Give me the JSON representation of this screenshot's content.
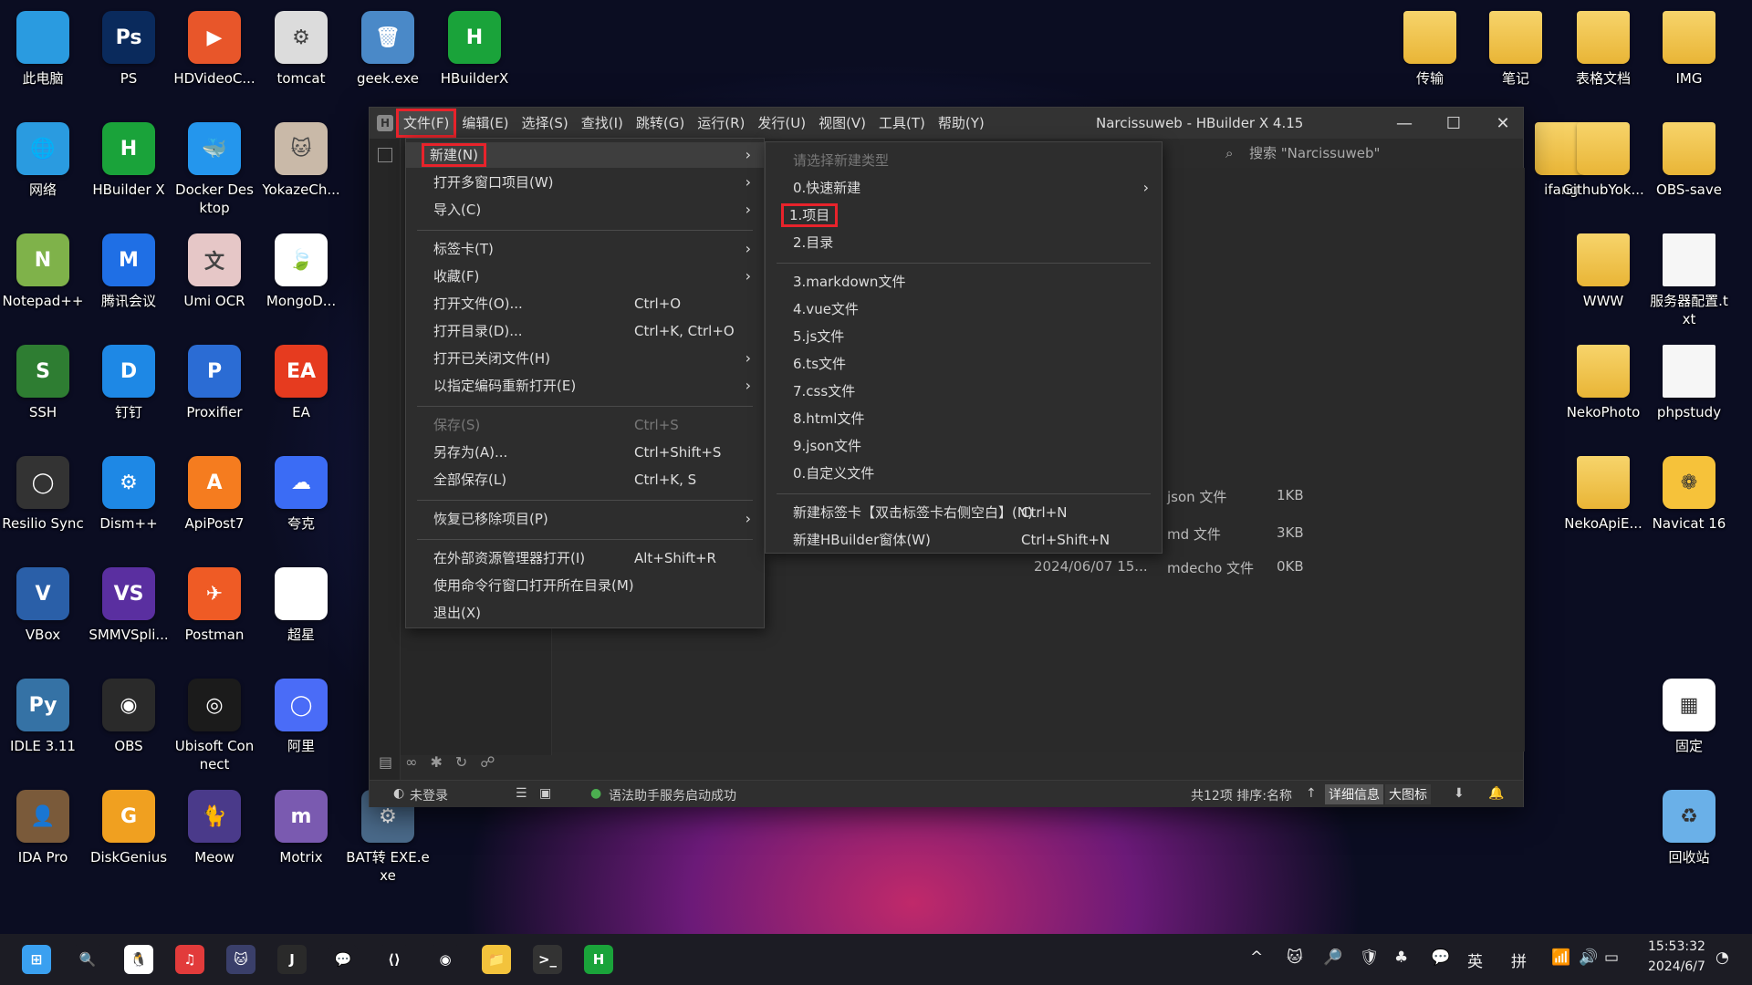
{
  "desktop_left": [
    {
      "label": "此电脑",
      "color": "#2a9be0",
      "icon": "monitor-icon"
    },
    {
      "label": "PS",
      "color": "#0a2a5c",
      "glyph": "Ps",
      "icon": "photoshop-icon"
    },
    {
      "label": "HDVideoC...",
      "color": "#e8562a",
      "glyph": "▶",
      "icon": "hdvideo-icon"
    },
    {
      "label": "tomcat",
      "color": "#dcdcdc",
      "glyph": "⚙",
      "icon": "gear-icon"
    },
    {
      "label": "geek.exe",
      "color": "#4a89c8",
      "glyph": "🗑",
      "icon": "geek-icon"
    },
    {
      "label": "HBuilderX",
      "color": "#1aa33a",
      "glyph": "H",
      "icon": "hbuilderx-icon"
    },
    {
      "label": "网络",
      "color": "#2a9be0",
      "glyph": "🌐",
      "icon": "network-icon"
    },
    {
      "label": "HBuilder X",
      "color": "#1aa33a",
      "glyph": "H",
      "icon": "hbuilder-icon"
    },
    {
      "label": "Docker Desktop",
      "color": "#2496ed",
      "glyph": "🐳",
      "icon": "docker-icon"
    },
    {
      "label": "YokazeCh...",
      "color": "#c9b9a8",
      "glyph": "🐱",
      "icon": "yokaze-icon"
    },
    {
      "label": "Notepad++",
      "color": "#7fb24a",
      "glyph": "N",
      "icon": "notepad-icon"
    },
    {
      "label": "腾讯会议",
      "color": "#1f6fe5",
      "glyph": "M",
      "icon": "tencent-meeting-icon"
    },
    {
      "label": "Umi OCR",
      "color": "#e6c7c7",
      "glyph": "文",
      "icon": "umi-ocr-icon"
    },
    {
      "label": "MongoD...",
      "color": "#ffffff",
      "glyph": "🍃",
      "icon": "mongodb-icon"
    },
    {
      "label": "SSH",
      "color": "#2e7d32",
      "glyph": "S",
      "icon": "ssh-icon"
    },
    {
      "label": "钉钉",
      "color": "#1e88e5",
      "glyph": "D",
      "icon": "dingtalk-icon"
    },
    {
      "label": "Proxifier",
      "color": "#2b6cd4",
      "glyph": "P",
      "icon": "proxifier-icon"
    },
    {
      "label": "EA",
      "color": "#e63b1f",
      "glyph": "EA",
      "icon": "ea-icon"
    },
    {
      "label": "Resilio Sync",
      "color": "#333333",
      "glyph": "◯",
      "icon": "resilio-icon"
    },
    {
      "label": "Dism++",
      "color": "#1e88e5",
      "glyph": "⚙",
      "icon": "dism-icon"
    },
    {
      "label": "ApiPost7",
      "color": "#f57c1f",
      "glyph": "A",
      "icon": "apipost-icon"
    },
    {
      "label": "夸克",
      "color": "#3b6cf5",
      "glyph": "☁",
      "icon": "quark-icon"
    },
    {
      "label": "VBox",
      "color": "#2a5fa8",
      "glyph": "V",
      "icon": "virtualbox-icon"
    },
    {
      "label": "SMMVSpli...",
      "color": "#5a2fa0",
      "glyph": "VS",
      "icon": "smmv-icon"
    },
    {
      "label": "Postman",
      "color": "#ef5b25",
      "glyph": "✈",
      "icon": "postman-icon"
    },
    {
      "label": "超星",
      "color": "#ffffff",
      "glyph": "",
      "icon": "file-icon"
    },
    {
      "label": "IDLE 3.11",
      "color": "#3572a5",
      "glyph": "Py",
      "icon": "python-icon"
    },
    {
      "label": "OBS",
      "color": "#2a2a2a",
      "glyph": "◉",
      "icon": "obs-icon"
    },
    {
      "label": "Ubisoft Connect",
      "color": "#1b1b1b",
      "glyph": "◎",
      "icon": "ubisoft-icon"
    },
    {
      "label": "阿里",
      "color": "#4a6cf7",
      "glyph": "◯",
      "icon": "aliyun-icon"
    },
    {
      "label": "IDA Pro",
      "color": "#7a5a3a",
      "glyph": "👤",
      "icon": "ida-icon"
    },
    {
      "label": "DiskGenius",
      "color": "#f0a020",
      "glyph": "G",
      "icon": "diskgenius-icon"
    },
    {
      "label": "Meow",
      "color": "#4a3a8a",
      "glyph": "🐈",
      "icon": "meow-icon"
    },
    {
      "label": "Motrix",
      "color": "#7a5ab0",
      "glyph": "m",
      "icon": "motrix-icon"
    },
    {
      "label": "BAT转 EXE.exe",
      "color": "#4a6a8a",
      "glyph": "⚙",
      "icon": "bat2exe-icon"
    }
  ],
  "desktop_right": [
    {
      "label": "传输",
      "type": "folder"
    },
    {
      "label": "笔记",
      "type": "folder"
    },
    {
      "label": "表格文档",
      "type": "folder"
    },
    {
      "label": "IMG",
      "type": "folder"
    },
    {
      "label": "ifang",
      "type": "folder"
    },
    {
      "label": "GithubYok...",
      "type": "folder"
    },
    {
      "label": "OBS-save",
      "type": "folder"
    },
    {
      "label": "WWW",
      "type": "folder"
    },
    {
      "label": "服务器配置.txt",
      "type": "doc"
    },
    {
      "label": "NekoPhoto",
      "type": "folder"
    },
    {
      "label": "phpstudy",
      "type": "doc"
    },
    {
      "label": "NekoApiE...",
      "type": "folder"
    },
    {
      "label": "Navicat 16",
      "type": "app"
    },
    {
      "label": "固定",
      "type": "app"
    },
    {
      "label": "回收站",
      "type": "app"
    }
  ],
  "window": {
    "title": "Narcissuweb - HBuilder X 4.15",
    "menu": [
      "文件(F)",
      "编辑(E)",
      "选择(S)",
      "查找(I)",
      "跳转(G)",
      "运行(R)",
      "发行(U)",
      "视图(V)",
      "工具(T)",
      "帮助(Y)"
    ],
    "search_placeholder": "搜索 \"Narcissuweb\"",
    "files": [
      {
        "date": "2024/06/07 15...",
        "type": "json 文件",
        "size": "1KB"
      },
      {
        "date": "2024/06/07 15...",
        "type": "md 文件",
        "size": "3KB"
      },
      {
        "date": "2024/06/07 15...",
        "type": "mdecho 文件",
        "size": "0KB"
      }
    ],
    "status": {
      "login": "未登录",
      "msg": "语法助手服务启动成功",
      "count": "共12项 排序:名称",
      "detail_btn": "详细信息",
      "large_btn": "大图标"
    }
  },
  "file_menu": [
    {
      "label": "新建(N)",
      "arrow": true,
      "highlight": true
    },
    {
      "label": "打开多窗口项目(W)",
      "arrow": true
    },
    {
      "label": "导入(C)",
      "arrow": true
    },
    {
      "sep": true
    },
    {
      "label": "标签卡(T)",
      "arrow": true
    },
    {
      "label": "收藏(F)",
      "arrow": true
    },
    {
      "label": "打开文件(O)...",
      "shortcut": "Ctrl+O"
    },
    {
      "label": "打开目录(D)...",
      "shortcut": "Ctrl+K, Ctrl+O"
    },
    {
      "label": "打开已关闭文件(H)",
      "arrow": true
    },
    {
      "label": "以指定编码重新打开(E)",
      "arrow": true
    },
    {
      "sep": true
    },
    {
      "label": "保存(S)",
      "shortcut": "Ctrl+S",
      "disabled": true
    },
    {
      "label": "另存为(A)...",
      "shortcut": "Ctrl+Shift+S"
    },
    {
      "label": "全部保存(L)",
      "shortcut": "Ctrl+K, S"
    },
    {
      "sep": true
    },
    {
      "label": "恢复已移除项目(P)",
      "arrow": true
    },
    {
      "sep": true
    },
    {
      "label": "在外部资源管理器打开(I)",
      "shortcut": "Alt+Shift+R"
    },
    {
      "label": "使用命令行窗口打开所在目录(M)"
    },
    {
      "label": "退出(X)"
    }
  ],
  "new_menu": [
    {
      "label": "请选择新建类型",
      "disabled": true
    },
    {
      "label": "0.快速新建",
      "arrow": true
    },
    {
      "label": "1.项目",
      "boxed": true
    },
    {
      "label": "2.目录"
    },
    {
      "sep": true
    },
    {
      "label": "3.markdown文件"
    },
    {
      "label": "4.vue文件"
    },
    {
      "label": "5.js文件"
    },
    {
      "label": "6.ts文件"
    },
    {
      "label": "7.css文件"
    },
    {
      "label": "8.html文件"
    },
    {
      "label": "9.json文件"
    },
    {
      "label": "0.自定义文件"
    },
    {
      "sep": true
    },
    {
      "label": "新建标签卡【双击标签卡右侧空白】(N)",
      "shortcut": "Ctrl+N"
    },
    {
      "label": "新建HBuilder窗体(W)",
      "shortcut": "Ctrl+Shift+N"
    }
  ],
  "taskbar": {
    "apps": [
      {
        "name": "start",
        "color": "#3aa0f0",
        "glyph": "⊞"
      },
      {
        "name": "search",
        "color": "#1c1c24",
        "glyph": "🔍"
      },
      {
        "name": "qq",
        "color": "#ffffff",
        "glyph": "🐧"
      },
      {
        "name": "netease-music",
        "color": "#e23b3b",
        "glyph": "♫"
      },
      {
        "name": "cat",
        "color": "#3a3f6a",
        "glyph": "🐱"
      },
      {
        "name": "jetbrains",
        "color": "#2a2a2a",
        "glyph": "J"
      },
      {
        "name": "wechat",
        "color": "#1c1c24",
        "glyph": "💬"
      },
      {
        "name": "vscode",
        "color": "#1c1c24",
        "glyph": "⟨⟩"
      },
      {
        "name": "chrome",
        "color": "#1c1c24",
        "glyph": "◉"
      },
      {
        "name": "explorer",
        "color": "#f3c33c",
        "glyph": "📁"
      },
      {
        "name": "terminal",
        "color": "#333333",
        "glyph": ">_"
      },
      {
        "name": "hbuilderx",
        "color": "#1aa33a",
        "glyph": "H"
      }
    ],
    "ime1": "英",
    "ime2": "拼",
    "time": "15:53:32",
    "date": "2024/6/7"
  }
}
